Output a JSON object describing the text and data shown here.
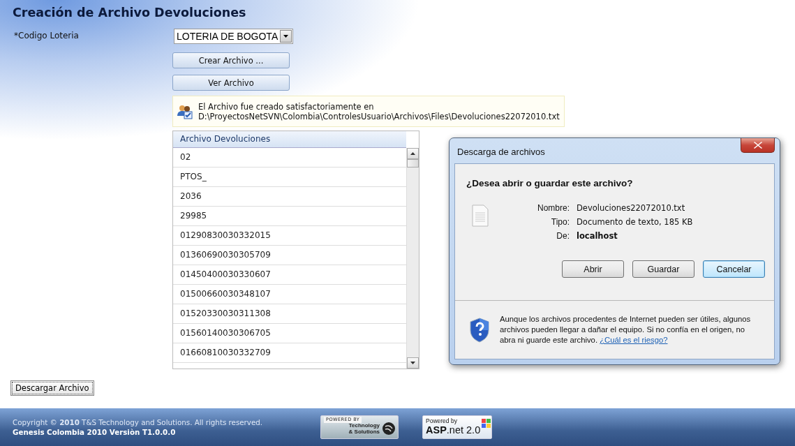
{
  "page": {
    "title": "Creación de Archivo Devoluciones"
  },
  "form": {
    "label": "*Codigo Loteria",
    "select_value": "LOTERIA DE BOGOTA",
    "buttons": [
      "Crear Archivo ...",
      "Ver Archivo"
    ]
  },
  "message": {
    "lines": [
      "El Archivo fue creado satisfactoriamente en",
      "D:\\ProyectosNetSVN\\Colombia\\ControlesUsuario\\Archivos\\Files\\Devoluciones22072010.txt"
    ]
  },
  "grid": {
    "column": "Archivo Devoluciones",
    "rows": [
      "02",
      "PTOS_",
      "2036",
      "29985",
      "01290830030332015",
      "01360690030305709",
      "01450400030330607",
      "01500660030348107",
      "01520330030311308",
      "01560140030306705",
      "01660810030332709"
    ]
  },
  "download_button": "Descargar Archivo",
  "dialog": {
    "title": "Descarga de archivos",
    "question": "¿Desea abrir o guardar este archivo?",
    "fields": [
      {
        "label": "Nombre:",
        "value": "Devoluciones22072010.txt",
        "emphasis": false
      },
      {
        "label": "Tipo:",
        "value": "Documento de texto, 185 KB",
        "emphasis": false
      },
      {
        "label": "De:",
        "value": "localhost",
        "emphasis": true
      }
    ],
    "buttons": [
      {
        "label": "Abrir",
        "default": false
      },
      {
        "label": "Guardar",
        "default": false
      },
      {
        "label": "Cancelar",
        "default": true
      }
    ],
    "warning": "Aunque los archivos procedentes de Internet pueden ser útiles, algunos archivos pueden llegar a dañar el equipo. Si no confía en el origen, no abra ni guarde este archivo.",
    "link": "¿Cuál es el riesgo?"
  },
  "footer": {
    "copyright": "Copyright ©  **2010**  T&S Technology and Solutions. All rights reserved.",
    "version": "Genesis Colombia 2010 Versiòn T1.0.0.0",
    "badges": [
      {
        "kind": "ts",
        "top": "POWERED BY",
        "lines": [
          "Technology",
          "& Solutions"
        ]
      },
      {
        "kind": "aspnet",
        "top": "Powered by",
        "main": "**ASP**.net 2.0"
      }
    ]
  }
}
